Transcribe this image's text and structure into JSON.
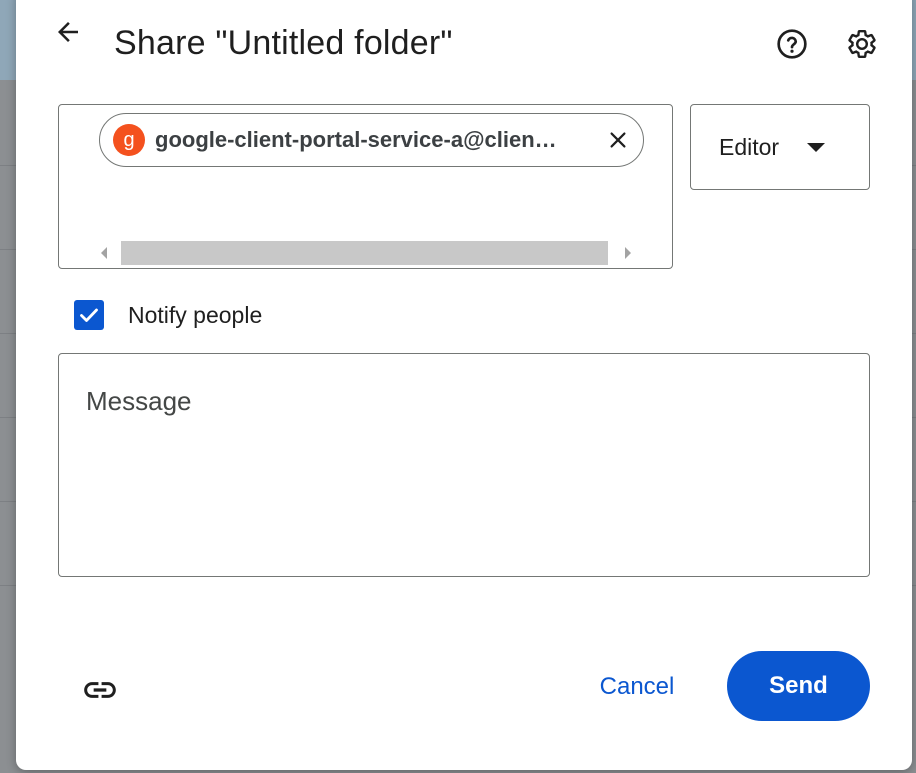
{
  "dialog": {
    "title": "Share \"Untitled folder\"",
    "back_icon": "arrow-left-icon",
    "help_icon": "help-circle-icon",
    "settings_icon": "gear-icon"
  },
  "recipients": {
    "chips": [
      {
        "avatar_letter": "g",
        "avatar_color": "#f4511e",
        "email": "google-client-portal-service-a@clien…"
      }
    ]
  },
  "role": {
    "selected": "Editor"
  },
  "notify": {
    "checked": true,
    "label": "Notify people"
  },
  "message": {
    "placeholder": "Message",
    "value": ""
  },
  "footer": {
    "link_icon": "link-icon",
    "cancel_label": "Cancel",
    "send_label": "Send"
  },
  "colors": {
    "accent": "#0b57d0",
    "avatar": "#f4511e"
  }
}
